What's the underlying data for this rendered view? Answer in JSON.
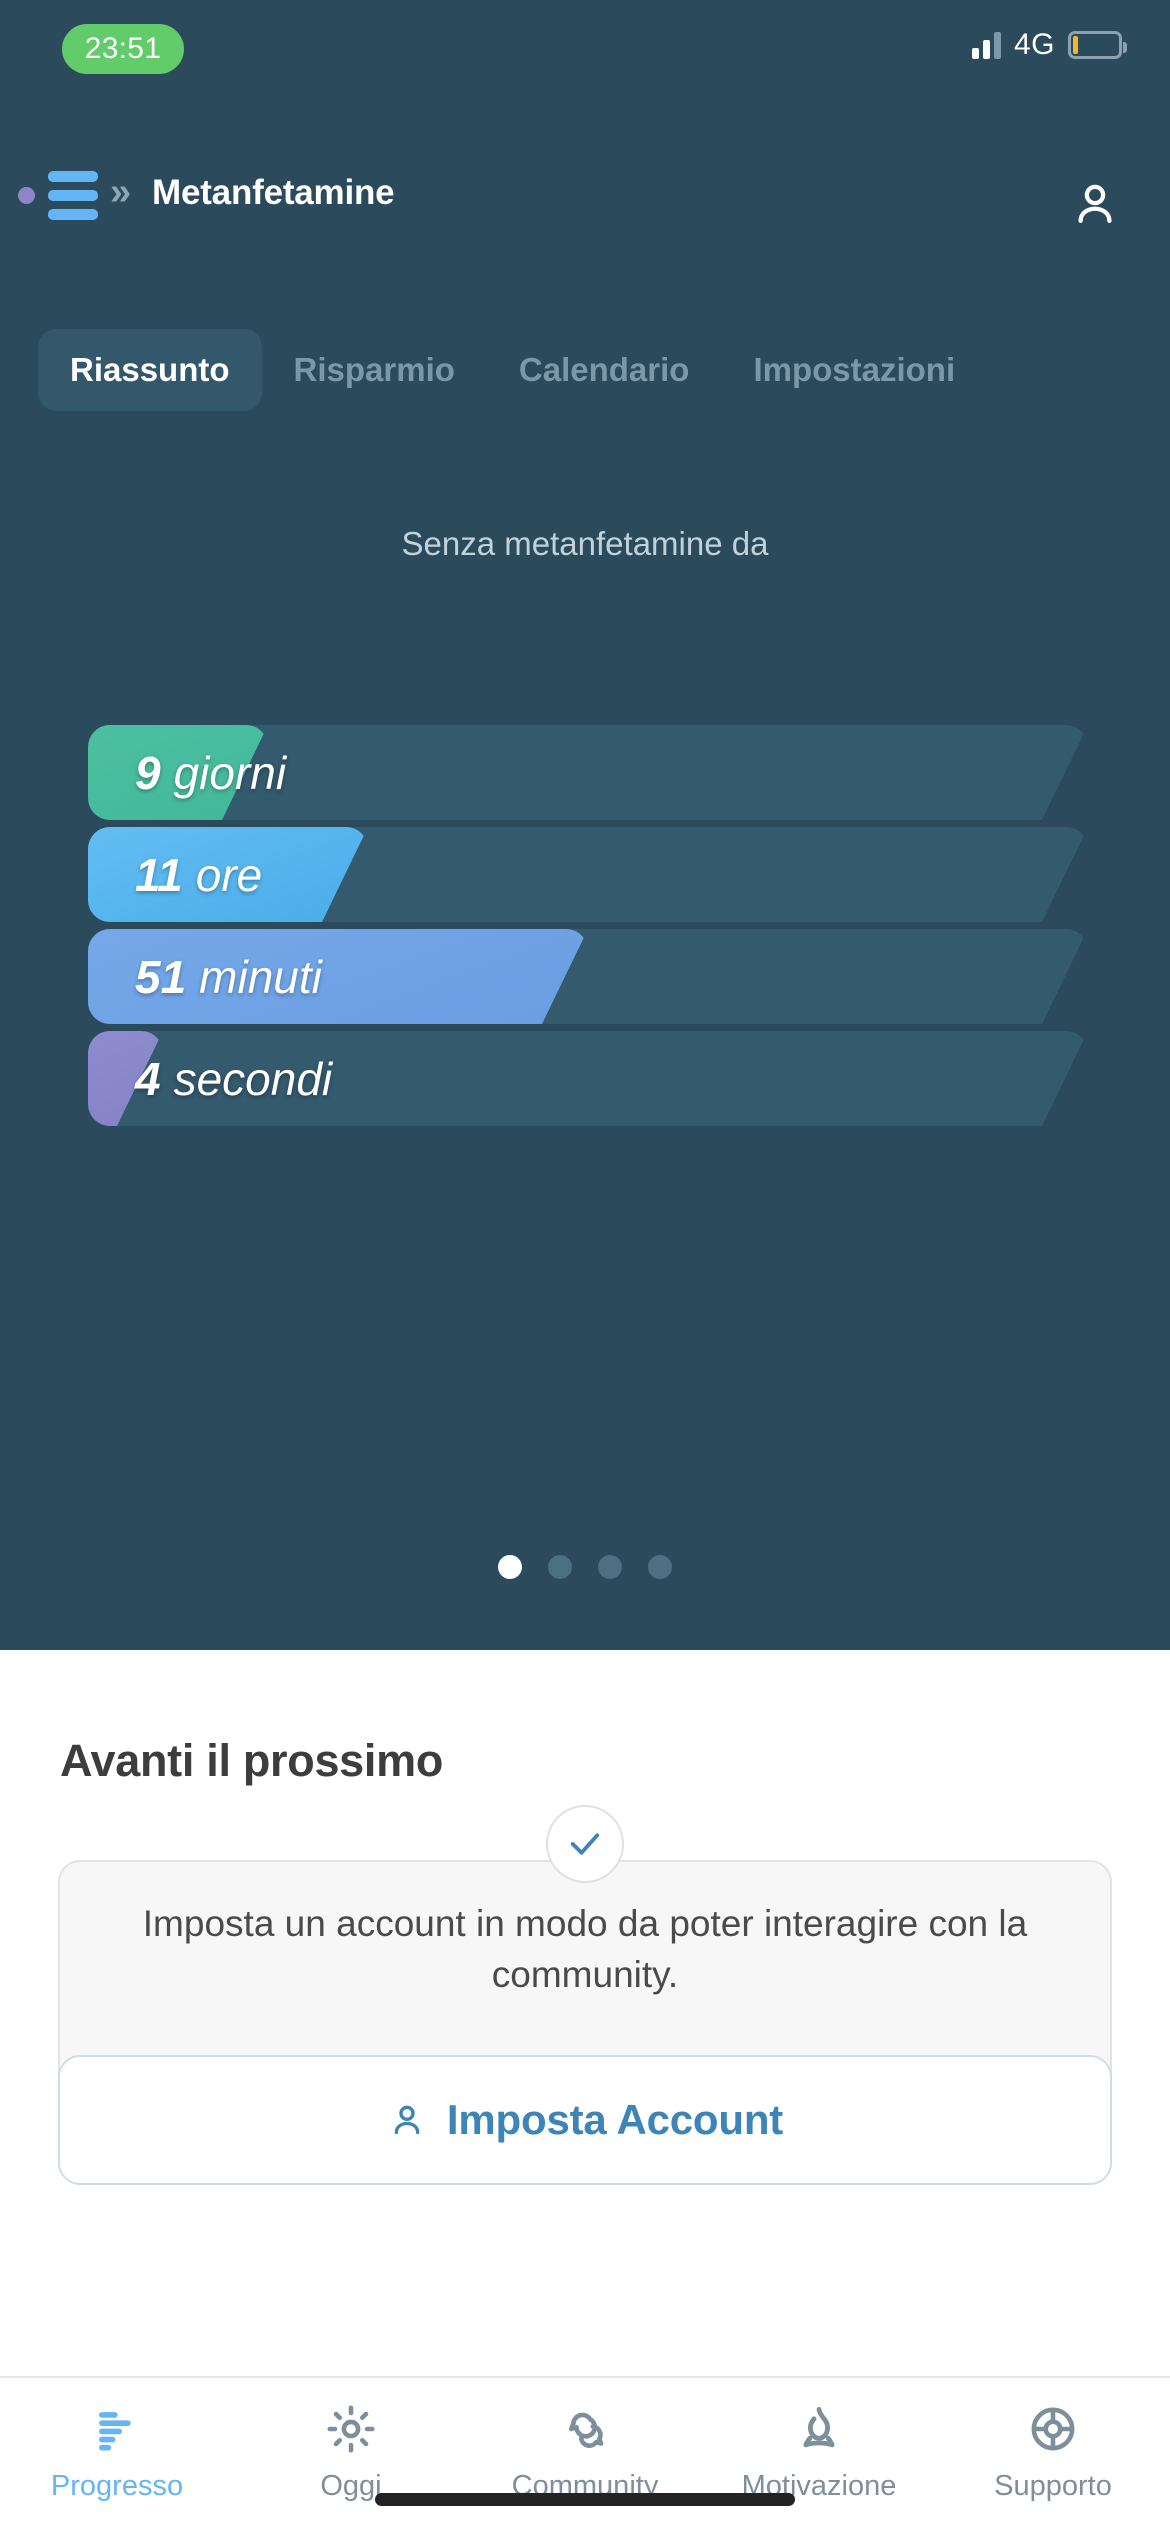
{
  "status_bar": {
    "time": "23:51",
    "network": "4G",
    "signal_icon": "signal-bars-icon",
    "battery_icon": "battery-low-icon"
  },
  "header": {
    "menu_icon": "hamburger-menu-icon",
    "badge_icon": "notification-dot-icon",
    "chevron_icon": "double-chevron-right-icon",
    "title": "Metanfetamine",
    "profile_icon": "user-profile-icon"
  },
  "tabs": [
    {
      "label": "Riassunto",
      "active": true
    },
    {
      "label": "Risparmio",
      "active": false
    },
    {
      "label": "Calendario",
      "active": false
    },
    {
      "label": "Impostazioni",
      "active": false
    }
  ],
  "counter": {
    "headline": "Senza metanfetamine da",
    "rows": [
      {
        "value": "9",
        "unit": "giorni",
        "fill_percent": 18,
        "color": "#4cc0a0",
        "color_end": "#42b79b"
      },
      {
        "value": "11",
        "unit": "ore",
        "fill_percent": 28,
        "color": "#63bdf2",
        "color_end": "#4aade8"
      },
      {
        "value": "51",
        "unit": "minuti",
        "fill_percent": 50,
        "color": "#74a8e8",
        "color_end": "#6a9ee2"
      },
      {
        "value": "4",
        "unit": "secondi",
        "fill_percent": 7.5,
        "color": "#8f8bcf",
        "color_end": "#8582c6"
      }
    ]
  },
  "pagination": {
    "total": 4,
    "active_index": 0
  },
  "sheet": {
    "title": "Avanti il prossimo",
    "check_icon": "check-mark-icon",
    "task_text": "Imposta un account in modo da poter interagire con la community.",
    "cta_label": "Imposta Account",
    "cta_icon": "user-profile-icon"
  },
  "bottom_nav": [
    {
      "label": "Progresso",
      "icon": "bar-chart-icon",
      "active": true
    },
    {
      "label": "Oggi",
      "icon": "sun-icon",
      "active": false
    },
    {
      "label": "Community",
      "icon": "chat-bubbles-icon",
      "active": false
    },
    {
      "label": "Motivazione",
      "icon": "flame-icon",
      "active": false
    },
    {
      "label": "Supporto",
      "icon": "lifebuoy-icon",
      "active": false
    }
  ],
  "colors": {
    "dark_bg": "#2b4a5c",
    "accent_blue": "#64b5f6",
    "track": "#345a6e",
    "time_pill_green": "#63cc6a"
  }
}
